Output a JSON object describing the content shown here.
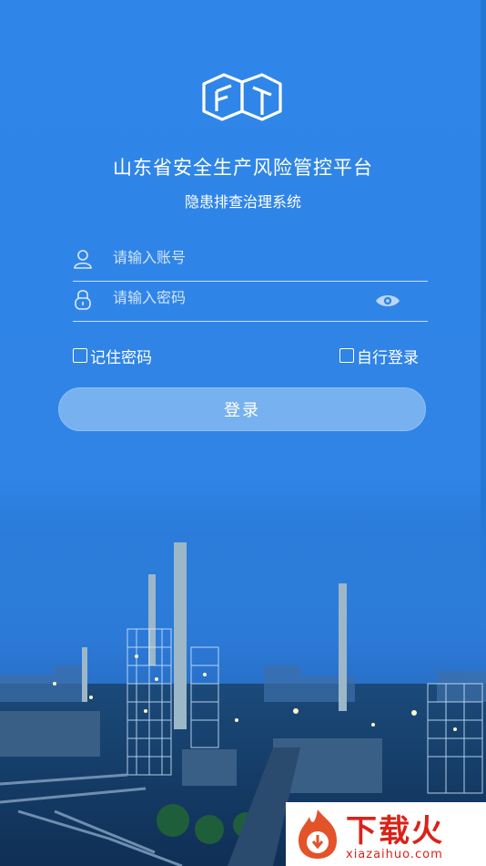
{
  "app": {
    "title": "山东省安全生产风险管控平台",
    "subtitle": "隐患排查治理系统"
  },
  "form": {
    "account_placeholder": "请输入账号",
    "password_placeholder": "请输入密码",
    "remember_label": "记住密码",
    "auto_login_label": "自行登录",
    "login_label": "登录"
  },
  "icons": {
    "logo": "cube-logo-icon",
    "account": "user-icon",
    "password": "lock-icon",
    "toggle": "eye-icon"
  },
  "watermark": {
    "brand": "下载火",
    "url": "xiazaihuo.com"
  },
  "colors": {
    "background": "#2f86e8",
    "button": "#78b1f0",
    "watermark": "#d9231a"
  }
}
